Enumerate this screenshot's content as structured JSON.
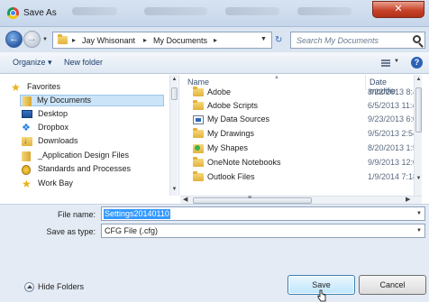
{
  "window": {
    "title": "Save As",
    "close_glyph": "✕"
  },
  "nav": {
    "back_glyph": "←",
    "forward_glyph": "→",
    "breadcrumb": [
      "Jay Whisonant",
      "My Documents"
    ],
    "separator": "▸",
    "refresh_glyph": "↻"
  },
  "search": {
    "placeholder": "Search My Documents"
  },
  "toolbar": {
    "organize_label": "Organize ▾",
    "new_folder_label": "New folder",
    "help_glyph": "?"
  },
  "sidebar": {
    "items": [
      {
        "label": "Favorites",
        "icon": "star-icon"
      },
      {
        "label": "My Documents",
        "icon": "folder-icon",
        "selected": true
      },
      {
        "label": "Desktop",
        "icon": "desktop-icon"
      },
      {
        "label": "Dropbox",
        "icon": "dropbox-icon"
      },
      {
        "label": "Downloads",
        "icon": "downloads-icon"
      },
      {
        "label": "_Application Design Files",
        "icon": "folder-icon"
      },
      {
        "label": "Standards and Processes",
        "icon": "shield-icon"
      },
      {
        "label": "Work Bay",
        "icon": "bookmark-icon"
      }
    ]
  },
  "columns": {
    "name": "Name",
    "date": "Date modifie"
  },
  "files": [
    {
      "name": "Adobe",
      "date": "8/22/2013 8:4",
      "icon": "folder-icon"
    },
    {
      "name": "Adobe Scripts",
      "date": "6/5/2013 11:4",
      "icon": "folder-icon"
    },
    {
      "name": "My Data Sources",
      "date": "9/23/2013 6:0",
      "icon": "data-sources-icon"
    },
    {
      "name": "My Drawings",
      "date": "9/5/2013 2:54",
      "icon": "folder-icon"
    },
    {
      "name": "My Shapes",
      "date": "8/20/2013 1:5",
      "icon": "shapes-folder-icon"
    },
    {
      "name": "OneNote Notebooks",
      "date": "9/9/2013 12:0",
      "icon": "folder-icon"
    },
    {
      "name": "Outlook Files",
      "date": "1/9/2014 7:18",
      "icon": "folder-icon"
    }
  ],
  "form": {
    "file_name_label": "File name:",
    "file_name_value": "Settings20140110",
    "save_type_label": "Save as type:",
    "save_type_value": "CFG File (.cfg)"
  },
  "footer": {
    "hide_folders_label": "Hide Folders",
    "save_label": "Save",
    "cancel_label": "Cancel"
  }
}
